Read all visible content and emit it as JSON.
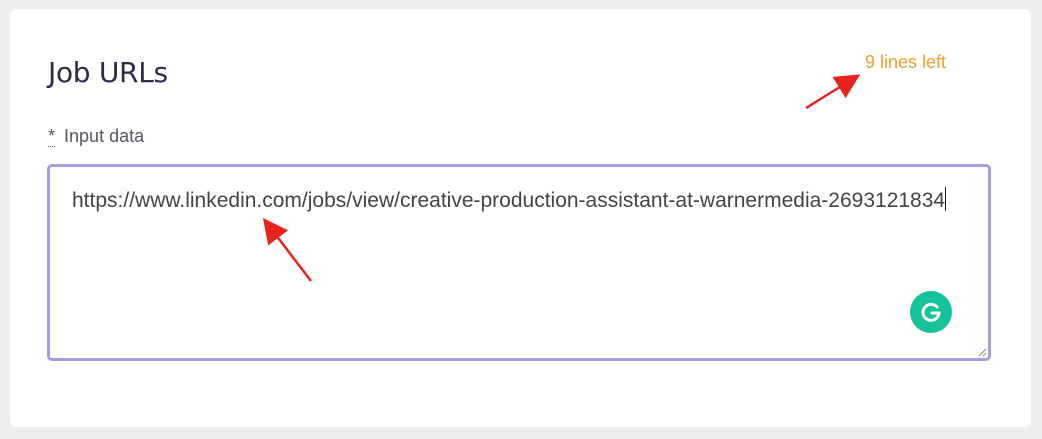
{
  "section": {
    "title": "Job URLs",
    "lines_left": "9 lines left"
  },
  "field": {
    "required_mark": "*",
    "label": "Input data",
    "value": "https://www.linkedin.com/jobs/view/creative-production-assistant-at-warnermedia-2693121834"
  },
  "icons": {
    "grammarly": "grammarly-icon",
    "resize": "resize-handle-icon"
  },
  "colors": {
    "accent_border": "#a99ae3",
    "lines_left": "#f0a030",
    "grammarly": "#15c39a",
    "annotation_arrow": "#e8231c"
  }
}
